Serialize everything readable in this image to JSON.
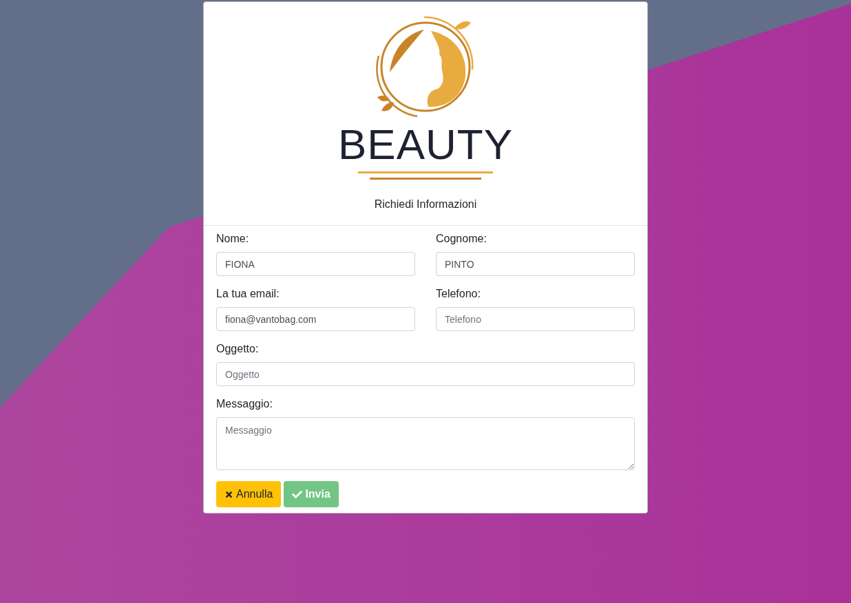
{
  "logo": {
    "wordmark": "BEAUTY"
  },
  "form": {
    "title": "Richiedi Informazioni",
    "fields": [
      {
        "kind": "input",
        "label": "Nome:",
        "value": "FIONA"
      },
      {
        "kind": "input",
        "label": "Cognome:",
        "value": "PINTO"
      },
      {
        "kind": "input",
        "label": "La tua email:",
        "value": "fiona@vantobag.com"
      },
      {
        "kind": "input",
        "label": "Telefono:",
        "placeholder": "Telefono"
      },
      {
        "kind": "wideinput",
        "label": "Oggetto:",
        "placeholder": "Oggetto"
      },
      {
        "kind": "textarea",
        "label": "Messaggio:",
        "placeholder": "Messaggio"
      }
    ],
    "buttons": [
      {
        "kind": "cancel",
        "label": "Annulla",
        "disabled": false
      },
      {
        "kind": "submit",
        "label": "Invia",
        "disabled": true
      }
    ]
  }
}
